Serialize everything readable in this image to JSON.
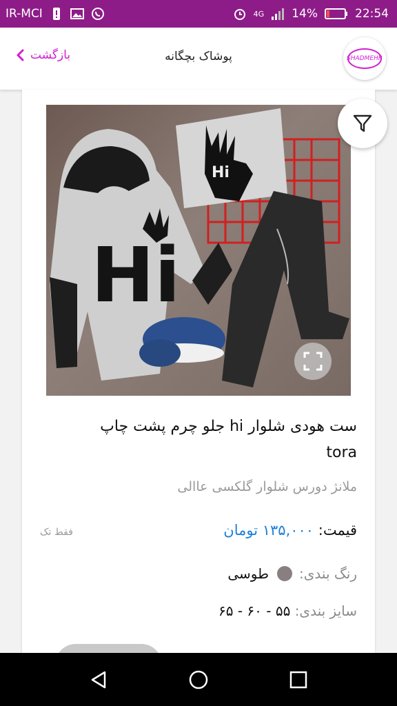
{
  "status_bar": {
    "carrier": "IR-MCI",
    "network": "4G",
    "battery": "14%",
    "time": "22:54"
  },
  "header": {
    "back_label": "بازگشت",
    "title": "پوشاک بچگانه",
    "logo_text": "SHADMEHR"
  },
  "product": {
    "title_line1": "ست هودی شلوار hi جلو چرم پشت چاپ",
    "title_line2": "tora",
    "description": "ملانژ دورس شلوار گلکسی عاالی",
    "price_label": "قیمت:",
    "price_value": "۱۳۵,۰۰۰ تومان",
    "single_only": "فقط تک",
    "color_label": "رنگ بندی:",
    "color_value": "طوسی",
    "color_hex": "#8a7f80",
    "size_label": "سایز بندی:",
    "size_value": "۵۵ - ۶۰ - ۶۵"
  },
  "colors": {
    "status_bar": "#8e1c88",
    "accent": "#d21fd2",
    "price": "#1b7fd6"
  }
}
